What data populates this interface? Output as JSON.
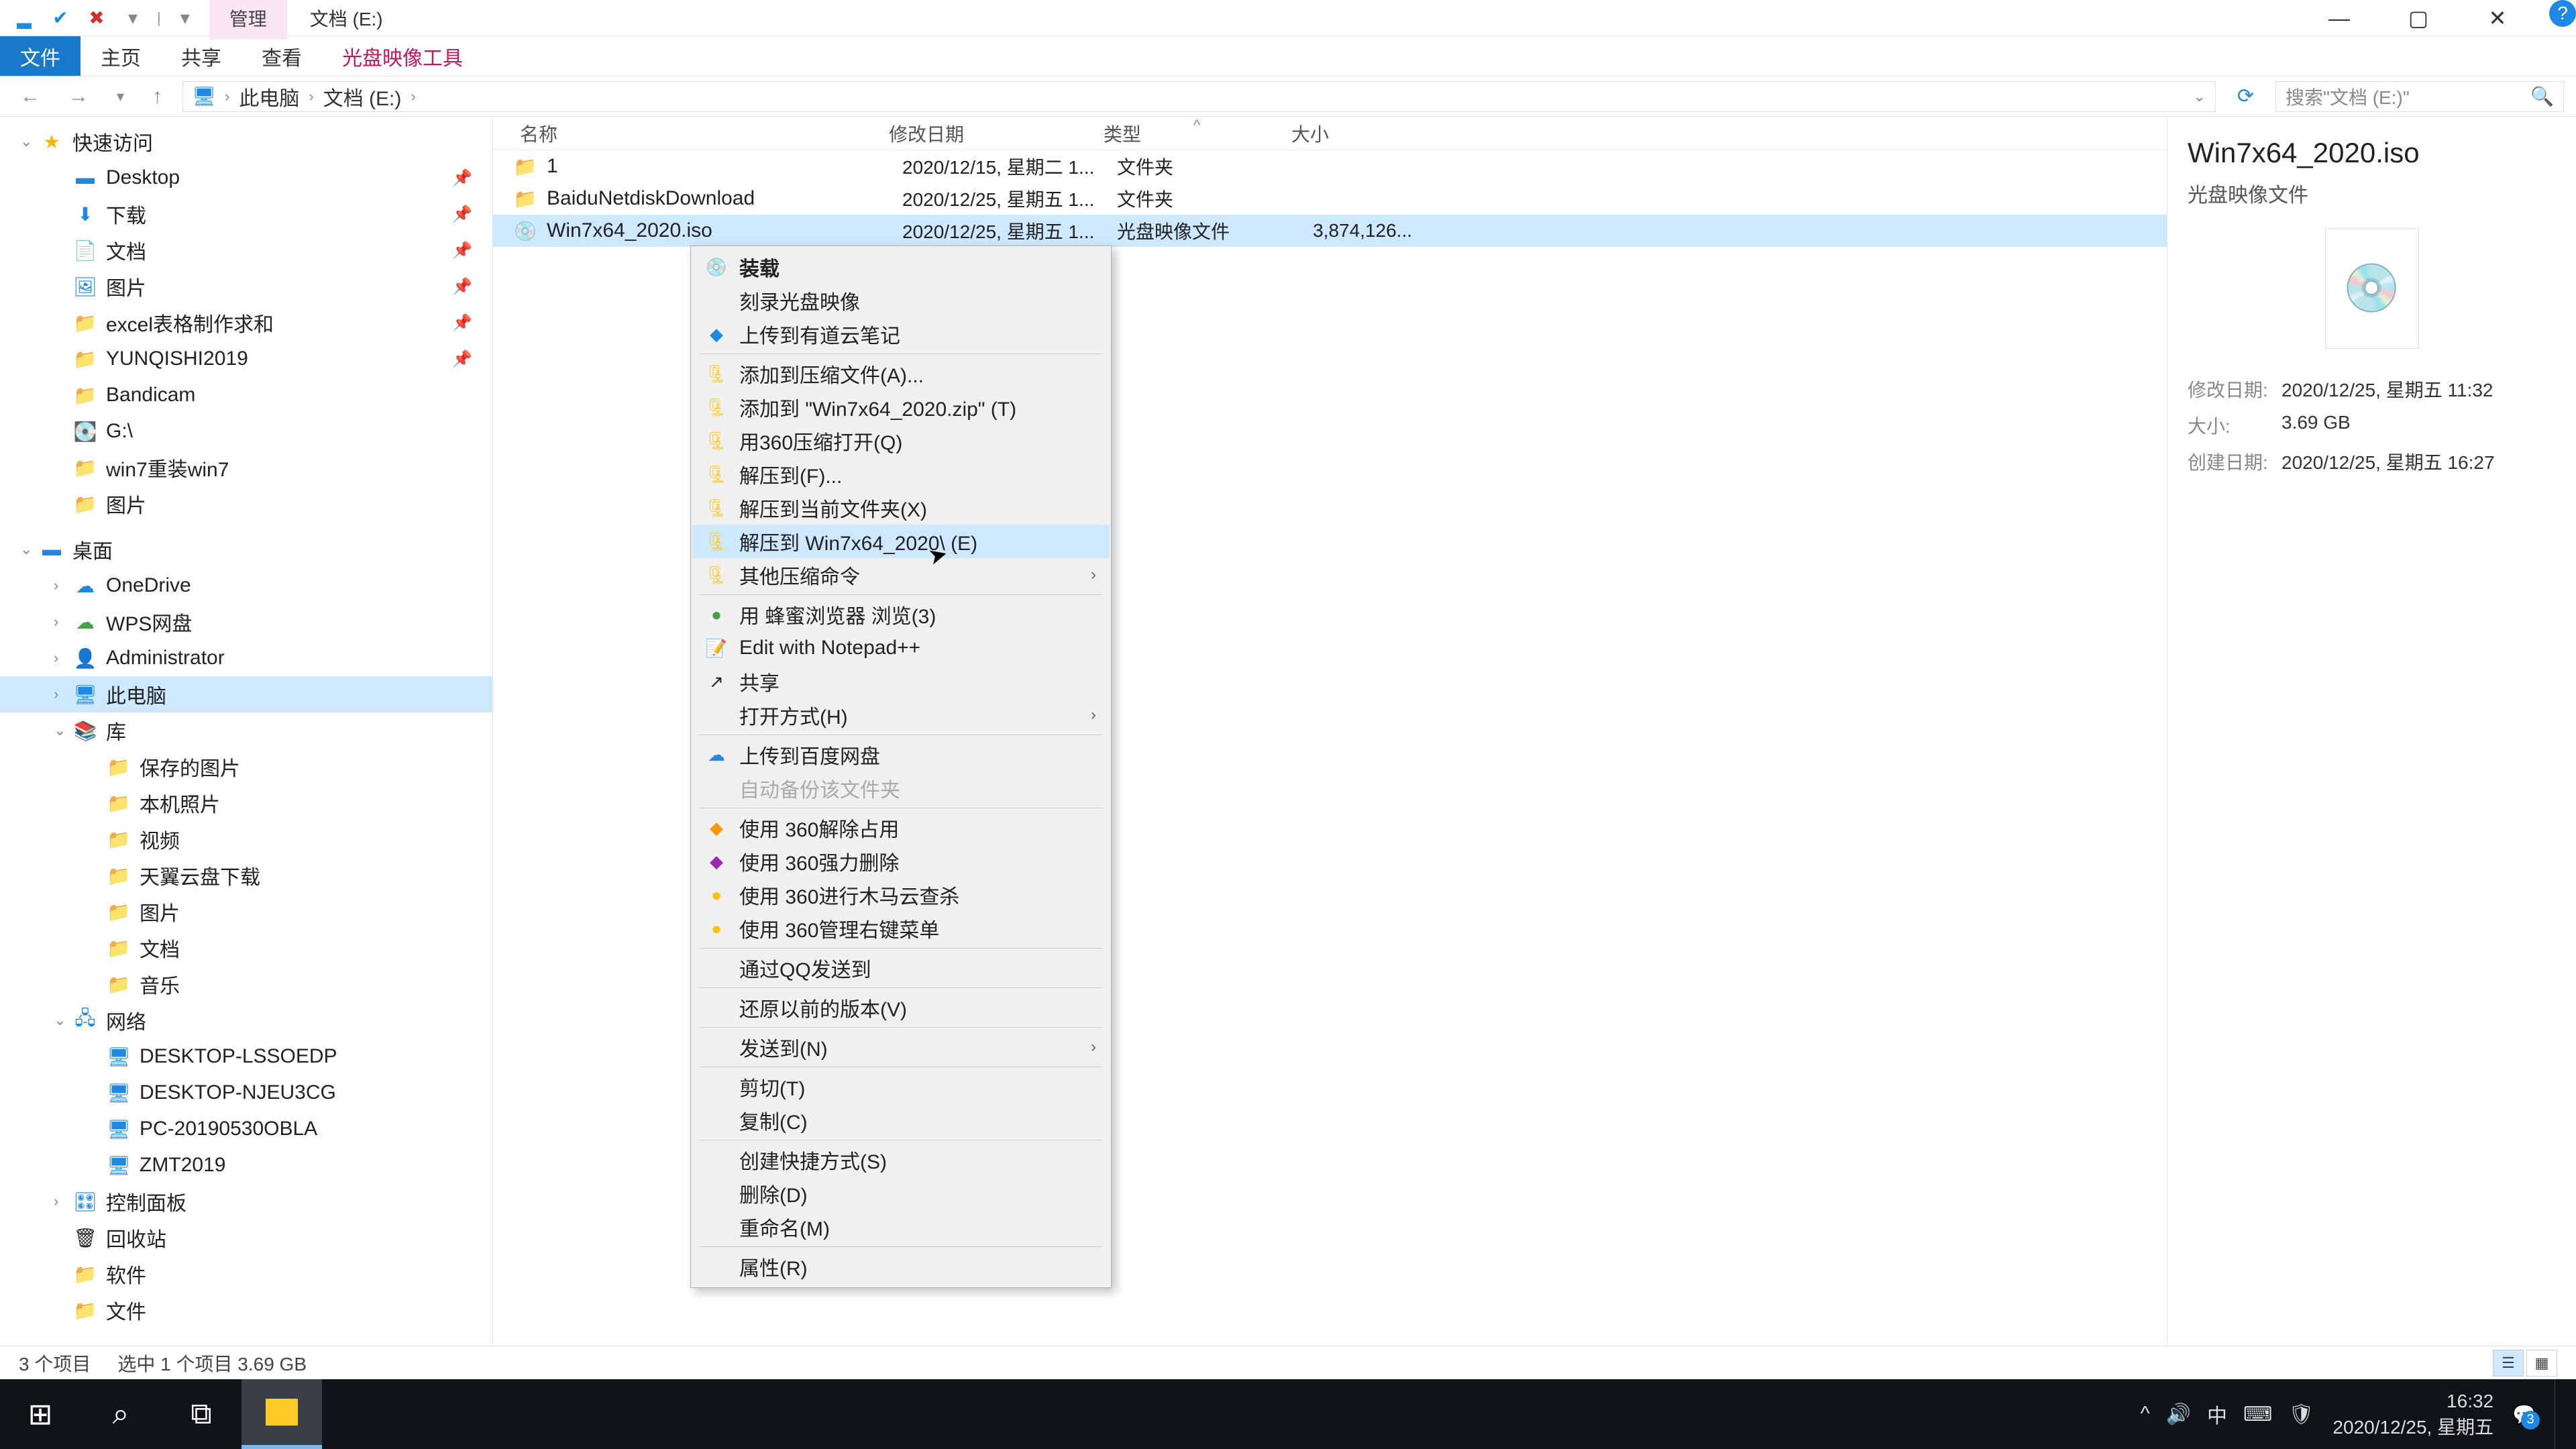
{
  "titlebar": {
    "manage_tab": "管理",
    "window_title": "文档 (E:)"
  },
  "ribbon": {
    "file": "文件",
    "home": "主页",
    "share": "共享",
    "view": "查看",
    "disc_tools": "光盘映像工具"
  },
  "breadcrumb": {
    "pc": "此电脑",
    "drive": "文档 (E:)"
  },
  "search": {
    "placeholder": "搜索\"文档 (E:)\""
  },
  "nav": {
    "quick": "快速访问",
    "desktop": "Desktop",
    "downloads": "下载",
    "documents": "文档",
    "pictures": "图片",
    "excel": "excel表格制作求和",
    "yunqishi": "YUNQISHI2019",
    "bandicam": "Bandicam",
    "gdrive": "G:\\",
    "win7": "win7重装win7",
    "pictures2": "图片",
    "desktop2": "桌面",
    "onedrive": "OneDrive",
    "wps": "WPS网盘",
    "admin": "Administrator",
    "thispc": "此电脑",
    "lib": "库",
    "saved_pic": "保存的图片",
    "local_pic": "本机照片",
    "video": "视频",
    "tianyi": "天翼云盘下载",
    "pic3": "图片",
    "doc2": "文档",
    "music": "音乐",
    "network": "网络",
    "pc1": "DESKTOP-LSSOEDP",
    "pc2": "DESKTOP-NJEU3CG",
    "pc3": "PC-20190530OBLA",
    "pc4": "ZMT2019",
    "cpanel": "控制面板",
    "recycle": "回收站",
    "soft": "软件",
    "files": "文件"
  },
  "columns": {
    "name": "名称",
    "date": "修改日期",
    "type": "类型",
    "size": "大小"
  },
  "rows": [
    {
      "name": "1",
      "date": "2020/12/15, 星期二 1...",
      "type": "文件夹",
      "size": ""
    },
    {
      "name": "BaiduNetdiskDownload",
      "date": "2020/12/25, 星期五 1...",
      "type": "文件夹",
      "size": ""
    },
    {
      "name": "Win7x64_2020.iso",
      "date": "2020/12/25, 星期五 1...",
      "type": "光盘映像文件",
      "size": "3,874,126..."
    }
  ],
  "details": {
    "title": "Win7x64_2020.iso",
    "subtitle": "光盘映像文件",
    "mdate_lbl": "修改日期:",
    "mdate": "2020/12/25, 星期五 11:32",
    "size_lbl": "大小:",
    "size": "3.69 GB",
    "cdate_lbl": "创建日期:",
    "cdate": "2020/12/25, 星期五 16:27"
  },
  "status": {
    "count": "3 个项目",
    "sel": "选中 1 个项目  3.69 GB"
  },
  "ctx": {
    "mount": "装载",
    "burn": "刻录光盘映像",
    "youdao": "上传到有道云笔记",
    "addarchive": "添加到压缩文件(A)...",
    "addzip": "添加到 \"Win7x64_2020.zip\" (T)",
    "open360": "用360压缩打开(Q)",
    "extractto": "解压到(F)...",
    "extracthere": "解压到当前文件夹(X)",
    "extractfolder": "解压到 Win7x64_2020\\ (E)",
    "othercomp": "其他压缩命令",
    "bee": "用 蜂蜜浏览器 浏览(3)",
    "npp": "Edit with Notepad++",
    "share": "共享",
    "openwith": "打开方式(H)",
    "baidu": "上传到百度网盘",
    "autobackup": "自动备份该文件夹",
    "unlock360": "使用 360解除占用",
    "forcedel": "使用 360强力删除",
    "trojan": "使用 360进行木马云查杀",
    "rightmenu": "使用 360管理右键菜单",
    "qqsend": "通过QQ发送到",
    "restore": "还原以前的版本(V)",
    "sendto": "发送到(N)",
    "cut": "剪切(T)",
    "copy": "复制(C)",
    "shortcut": "创建快捷方式(S)",
    "delete": "删除(D)",
    "rename": "重命名(M)",
    "props": "属性(R)"
  },
  "taskbar": {
    "ime": "中",
    "time": "16:32",
    "date": "2020/12/25, 星期五"
  }
}
